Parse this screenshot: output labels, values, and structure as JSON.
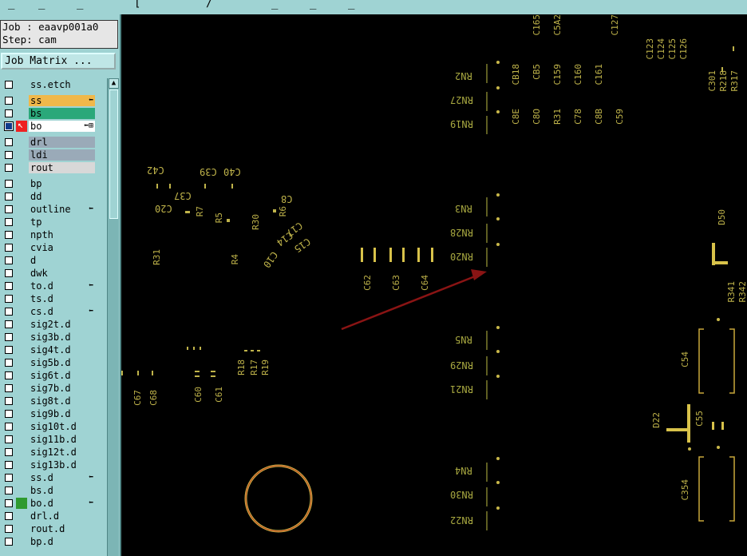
{
  "menubar": {
    "items": [
      "_",
      "_",
      "_",
      "[",
      "/",
      "_",
      "_",
      "_"
    ]
  },
  "job": {
    "job_line": "Job : eaavp001a0",
    "step_line": "Step: cam",
    "matrix_button": "Job Matrix ..."
  },
  "layers": [
    {
      "name": "ss.etch",
      "color": "#9fd3d3",
      "flag": ""
    },
    {
      "name": "ss",
      "color": "#f0b84a",
      "flag": "⬅"
    },
    {
      "name": "bs",
      "color": "#2aa87a",
      "flag": ""
    },
    {
      "name": "bo",
      "color": "#ffffff",
      "flag": "⬅⊞"
    },
    {
      "name": "drl",
      "color": "#9aaab8",
      "flag": ""
    },
    {
      "name": "ldi",
      "color": "#9aaab8",
      "flag": ""
    },
    {
      "name": "rout",
      "color": "#d8d8d8",
      "flag": ""
    },
    {
      "name": "bp",
      "color": "#9fd3d3",
      "flag": ""
    },
    {
      "name": "dd",
      "color": "#9fd3d3",
      "flag": ""
    },
    {
      "name": "outline",
      "color": "#9fd3d3",
      "flag": "⬅"
    },
    {
      "name": "tp",
      "color": "#9fd3d3",
      "flag": ""
    },
    {
      "name": "npth",
      "color": "#9fd3d3",
      "flag": ""
    },
    {
      "name": "cvia",
      "color": "#9fd3d3",
      "flag": ""
    },
    {
      "name": "d",
      "color": "#9fd3d3",
      "flag": ""
    },
    {
      "name": "dwk",
      "color": "#9fd3d3",
      "flag": ""
    },
    {
      "name": "to.d",
      "color": "#9fd3d3",
      "flag": "⬅"
    },
    {
      "name": "ts.d",
      "color": "#9fd3d3",
      "flag": ""
    },
    {
      "name": "cs.d",
      "color": "#9fd3d3",
      "flag": "⬅"
    },
    {
      "name": "sig2t.d",
      "color": "#9fd3d3",
      "flag": ""
    },
    {
      "name": "sig3b.d",
      "color": "#9fd3d3",
      "flag": ""
    },
    {
      "name": "sig4t.d",
      "color": "#9fd3d3",
      "flag": ""
    },
    {
      "name": "sig5b.d",
      "color": "#9fd3d3",
      "flag": ""
    },
    {
      "name": "sig6t.d",
      "color": "#9fd3d3",
      "flag": ""
    },
    {
      "name": "sig7b.d",
      "color": "#9fd3d3",
      "flag": ""
    },
    {
      "name": "sig8t.d",
      "color": "#9fd3d3",
      "flag": ""
    },
    {
      "name": "sig9b.d",
      "color": "#9fd3d3",
      "flag": ""
    },
    {
      "name": "sig10t.d",
      "color": "#9fd3d3",
      "flag": ""
    },
    {
      "name": "sig11b.d",
      "color": "#9fd3d3",
      "flag": ""
    },
    {
      "name": "sig12t.d",
      "color": "#9fd3d3",
      "flag": ""
    },
    {
      "name": "sig13b.d",
      "color": "#9fd3d3",
      "flag": ""
    },
    {
      "name": "ss.d",
      "color": "#9fd3d3",
      "flag": "⬅"
    },
    {
      "name": "bs.d",
      "color": "#9fd3d3",
      "flag": ""
    },
    {
      "name": "bo.d",
      "color": "#9fd3d3",
      "flag": "⬅"
    },
    {
      "name": "drl.d",
      "color": "#9fd3d3",
      "flag": ""
    },
    {
      "name": "rout.d",
      "color": "#9fd3d3",
      "flag": ""
    },
    {
      "name": "bp.d",
      "color": "#9fd3d3",
      "flag": ""
    }
  ],
  "canvas": {
    "refdes_top": [
      "CB18",
      "CB5",
      "C159",
      "C160",
      "C161",
      "C8E",
      "C8O",
      "R31",
      "C78",
      "C8B",
      "C59",
      "C165",
      "C5A2",
      "C123",
      "C124",
      "C125",
      "C126",
      "C127",
      "C301",
      "R218",
      "R317"
    ],
    "rn_labels": [
      "RN2",
      "RN27",
      "RN19",
      "RN3",
      "RN28",
      "RN20",
      "RN5",
      "RN29",
      "RN21",
      "RN4",
      "RN30",
      "RN22"
    ],
    "cluster_labels": [
      "C42",
      "C39",
      "C40",
      "C37",
      "C20",
      "R7",
      "R5",
      "R4",
      "R30",
      "C17",
      "C14",
      "C15",
      "C10",
      "R6",
      "C8",
      "R31",
      "C62",
      "C63",
      "C64",
      "C67",
      "C68",
      "C60",
      "C61",
      "R18",
      "R17",
      "R19",
      "C54",
      "C55",
      "D22",
      "D50",
      "R341",
      "R342",
      "C354"
    ]
  }
}
